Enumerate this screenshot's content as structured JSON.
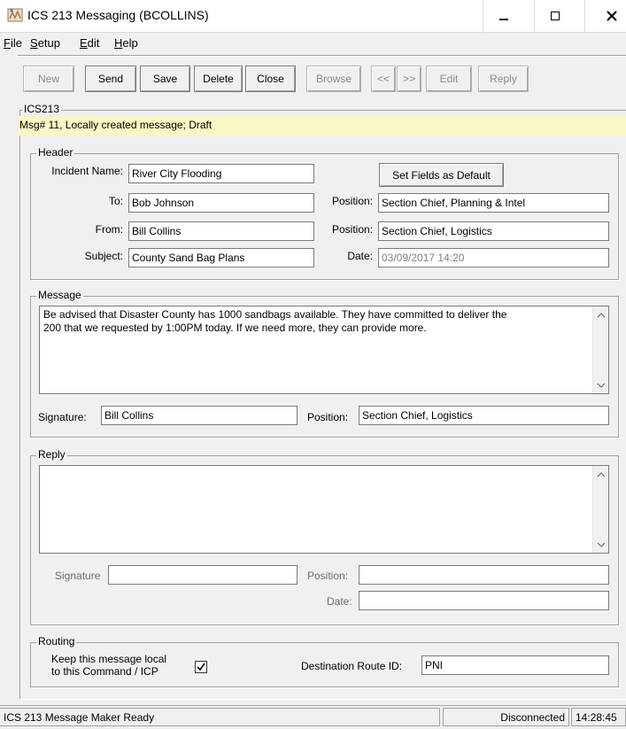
{
  "window": {
    "title": "ICS 213 Messaging (BCOLLINS)"
  },
  "menu": [
    {
      "label": "File",
      "accel": "F",
      "rest": "ile"
    },
    {
      "label": "Setup",
      "accel": "S",
      "rest": "etup"
    },
    {
      "label": "Edit",
      "accel": "E",
      "rest": "dit"
    },
    {
      "label": "Help",
      "accel": "H",
      "rest": "elp"
    }
  ],
  "toolbar": {
    "new": "New",
    "send": "Send",
    "save": "Save",
    "delete": "Delete",
    "close": "Close",
    "browse": "Browse",
    "prev": "<<",
    "next": ">>",
    "edit": "Edit",
    "reply": "Reply"
  },
  "form": {
    "group_label": "ICS213",
    "banner": "Msg# 11,  Locally created message; Draft",
    "header": {
      "label": "Header",
      "incident_label": "Incident Name:",
      "incident": "River City Flooding",
      "set_default": "Set Fields as Default",
      "to_label": "To:",
      "to": "Bob Johnson",
      "to_position_label": "Position:",
      "to_position": "Section Chief, Planning & Intel",
      "from_label": "From:",
      "from": "Bill Collins",
      "from_position_label": "Position:",
      "from_position": "Section Chief, Logistics",
      "subject_label": "Subject:",
      "subject": "County Sand Bag Plans",
      "date_label": "Date:",
      "date": "03/09/2017 14:20"
    },
    "message": {
      "label": "Message",
      "line1": "Be advised that Disaster County  has 1000 sandbags available.  They have committed to deliver the",
      "line2": "200 that we requested by 1:00PM today.  If we need more, they can provide more.",
      "signature_label": "Signature:",
      "signature": "Bill Collins",
      "position_label": "Position:",
      "position": "Section Chief, Logistics"
    },
    "reply": {
      "label": "Reply",
      "text": "",
      "signature_label": "Signature",
      "signature": "",
      "position_label": "Position:",
      "position": "",
      "date_label": "Date:",
      "date": ""
    },
    "routing": {
      "label": "Routing",
      "keep_local_line1": "Keep this message local",
      "keep_local_line2": "to this Command / ICP",
      "keep_local_checked": true,
      "dest_label": "Destination Route ID:",
      "dest": "PNI"
    }
  },
  "status": {
    "message": "ICS 213 Message Maker Ready",
    "connection": "Disconnected",
    "time": "14:28:45"
  }
}
